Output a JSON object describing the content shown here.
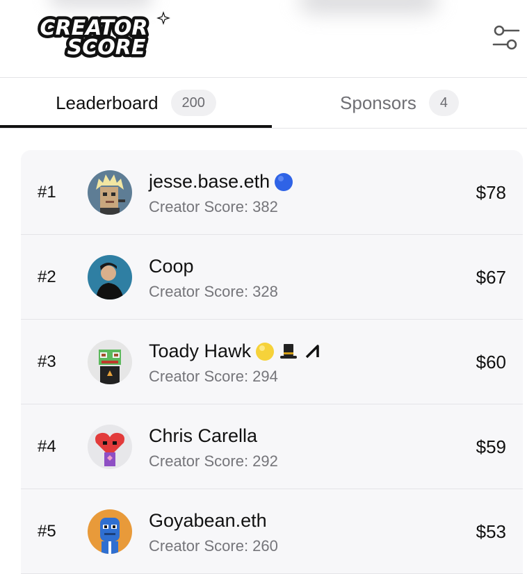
{
  "header": {
    "logo_line1": "CREATOR",
    "logo_line2": "SCORE",
    "filter_icon": "sliders-icon"
  },
  "tabs": [
    {
      "label": "Leaderboard",
      "count": "200",
      "active": true
    },
    {
      "label": "Sponsors",
      "count": "4",
      "active": false
    }
  ],
  "leaderboard": [
    {
      "rank": "#1",
      "name": "jesse.base.eth",
      "badges": [
        "blue-circle-icon"
      ],
      "score": "Creator Score: 382",
      "amount": "$78"
    },
    {
      "rank": "#2",
      "name": "Coop",
      "badges": [],
      "score": "Creator Score: 328",
      "amount": "$67"
    },
    {
      "rank": "#3",
      "name": "Toady Hawk",
      "badges": [
        "yellow-circle-icon",
        "top-hat-icon",
        "arrow-mark-icon"
      ],
      "score": "Creator Score: 294",
      "amount": "$60"
    },
    {
      "rank": "#4",
      "name": "Chris Carella",
      "badges": [],
      "score": "Creator Score: 292",
      "amount": "$59"
    },
    {
      "rank": "#5",
      "name": "Goyabean.eth",
      "badges": [],
      "score": "Creator Score: 260",
      "amount": "$53"
    }
  ],
  "colors": {
    "list_bg": "#f7f7f9",
    "muted_text": "#75757a",
    "active_tab_underline": "#111111",
    "badge_blue": "#2f63e6",
    "badge_yellow": "#f6d23a"
  }
}
